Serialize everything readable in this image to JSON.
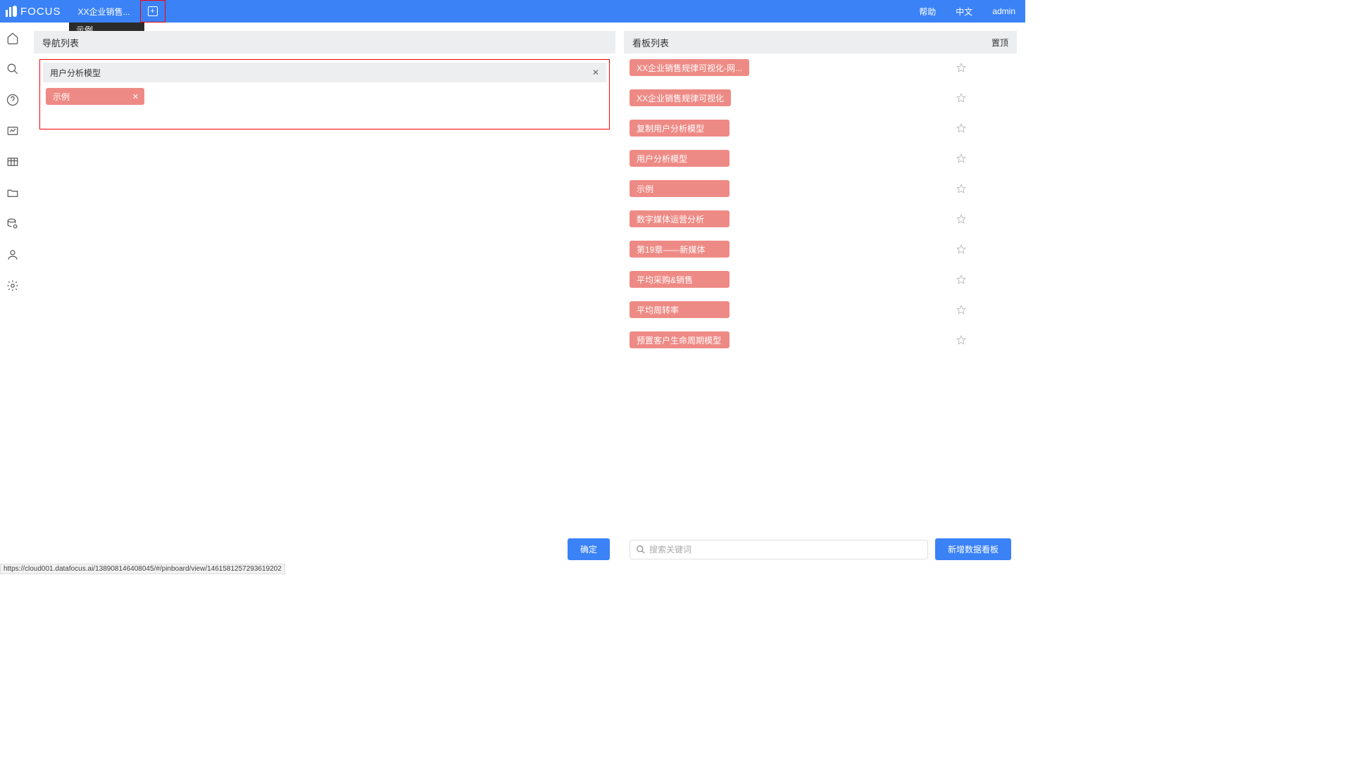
{
  "header": {
    "brand": "FOCUS",
    "tab_label": "XX企业销售...",
    "tooltip": "示例",
    "links": {
      "help": "帮助",
      "lang": "中文",
      "user": "admin"
    }
  },
  "panels": {
    "nav_title": "导航列表",
    "board_title": "看板列表",
    "pin": "置顶"
  },
  "nav_card": {
    "title": "用户分析模型",
    "chip": "示例"
  },
  "board_items": [
    "XX企业销售规律可视化-网...",
    "XX企业销售规律可视化",
    "复制用户分析模型",
    "用户分析模型",
    "示例",
    "数字媒体运营分析",
    "第19章——新媒体",
    "平均采购&销售",
    "平均周转率",
    "预置客户生命周期模型"
  ],
  "buttons": {
    "confirm": "确定",
    "new_board": "新增数据看板"
  },
  "search": {
    "placeholder": "搜索关键词"
  },
  "status_url": "https://cloud001.datafocus.ai/138908146408045/#/pinboard/view/1461581257293619202"
}
